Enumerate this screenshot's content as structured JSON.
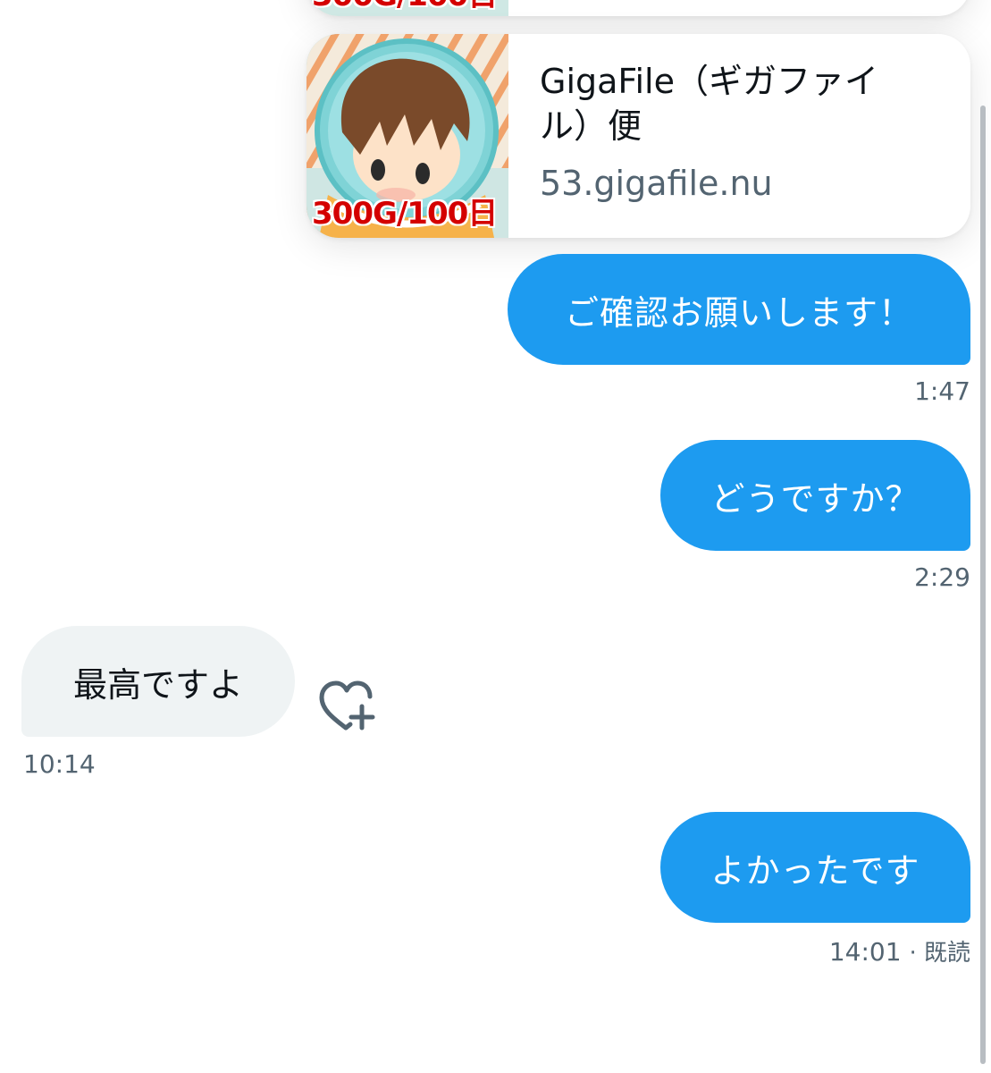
{
  "top_card": {
    "thumb_badge": "300G/100日"
  },
  "link_card": {
    "title": "GigaFile（ギガファイル）便",
    "domain": "53.gigafile.nu",
    "thumb_badge": "300G/100日"
  },
  "messages": [
    {
      "text": "ご確認お願いします！",
      "time": "1:47"
    },
    {
      "text": "どうですか？",
      "time": "2:29"
    },
    {
      "text": "最高ですよ",
      "time": "10:14"
    },
    {
      "text": "よかったです",
      "time": "14:01",
      "status": "· 既読"
    }
  ],
  "colors": {
    "outgoing": "#1d9bf0",
    "incoming": "#eff3f4",
    "meta": "#536471"
  },
  "icons": {
    "react": "heart-plus-icon"
  }
}
